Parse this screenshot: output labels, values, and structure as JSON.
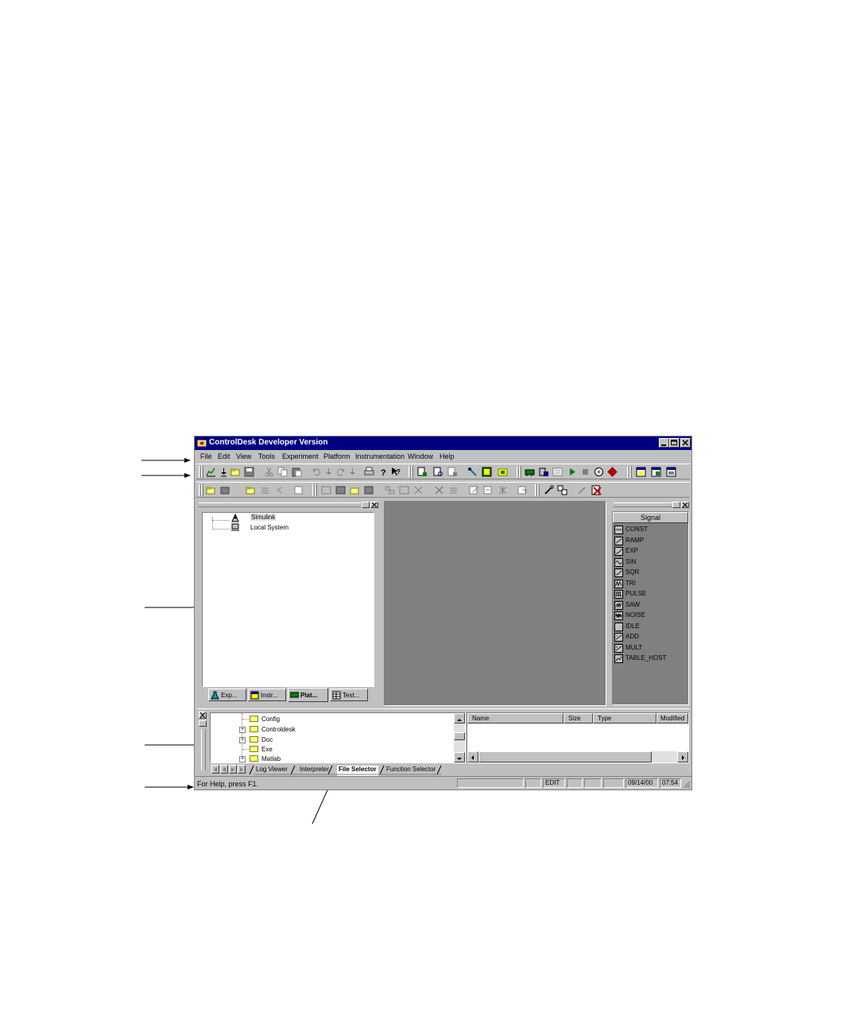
{
  "window": {
    "title": "ControlDesk Developer Version"
  },
  "menu": [
    "File",
    "Edit",
    "View",
    "Tools",
    "Experiment",
    "Platform",
    "Instrumentation",
    "Window",
    "Help"
  ],
  "tree": {
    "items": [
      "Simulink",
      "Local System"
    ]
  },
  "nav_tabs": [
    "Exp...",
    "Instr...",
    "Plat...",
    "Test..."
  ],
  "signal_panel": {
    "header": "Signal",
    "items": [
      "CONST",
      "RAMP",
      "EXP",
      "SIN",
      "SQR",
      "TRI",
      "PULSE",
      "SAW",
      "NOISE",
      "IDLE",
      "ADD",
      "MULT",
      "TABLE_HOST"
    ]
  },
  "file_selector": {
    "folders": [
      "Config",
      "Controldesk",
      "Doc",
      "Exe",
      "Matlab"
    ],
    "columns": [
      "Name",
      "Size",
      "Type",
      "Modified"
    ]
  },
  "bottom_tabs": [
    "Log Viewer",
    "Interpreter",
    "File Selector",
    "Function Selector"
  ],
  "status": {
    "help": "For Help, press F1.",
    "mode": "EDIT",
    "date": "09/14/00",
    "time": "07:54"
  },
  "colors": {
    "title_bar": "#000080",
    "face": "#c0c0c0",
    "workspace": "#808080"
  }
}
